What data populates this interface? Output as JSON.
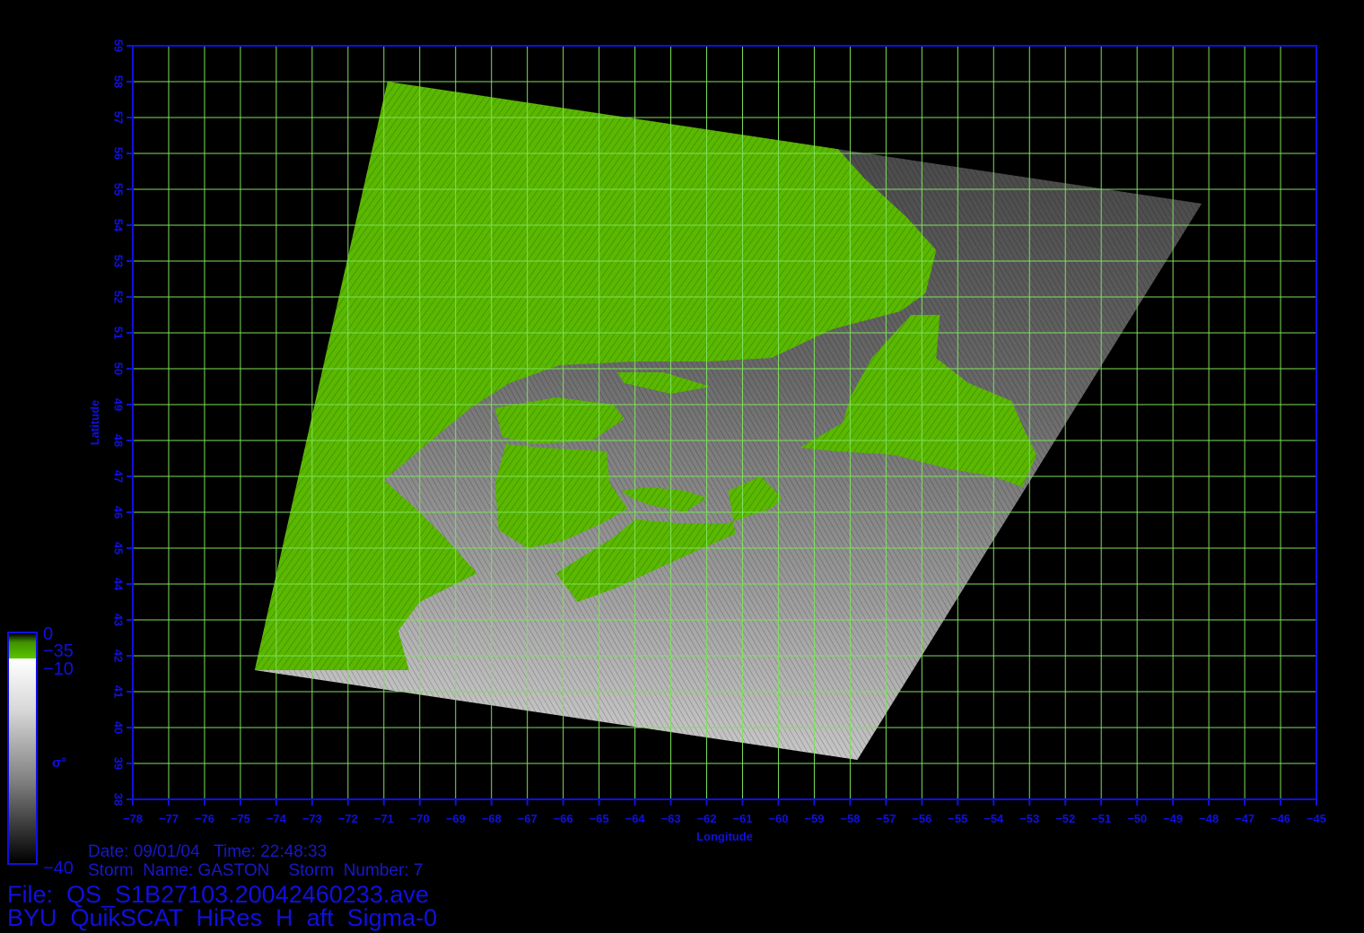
{
  "chart_data": {
    "type": "map",
    "xlabel": "Longitude",
    "ylabel": "Latitude",
    "xlim": [
      -78,
      -45
    ],
    "ylim": [
      38,
      59
    ],
    "x_ticks": [
      -78,
      -77,
      -76,
      -75,
      -74,
      -73,
      -72,
      -71,
      -70,
      -69,
      -68,
      -67,
      -66,
      -65,
      -64,
      -63,
      -62,
      -61,
      -60,
      -59,
      -58,
      -57,
      -56,
      -55,
      -54,
      -53,
      -52,
      -51,
      -50,
      -49,
      -48,
      -47,
      -46,
      -45
    ],
    "y_ticks": [
      38,
      39,
      40,
      41,
      42,
      43,
      44,
      45,
      46,
      47,
      48,
      49,
      50,
      51,
      52,
      53,
      54,
      55,
      56,
      57,
      58,
      59
    ],
    "grid": true,
    "swath_corners_lonlat": [
      [
        -70.9,
        58.0
      ],
      [
        -48.2,
        54.6
      ],
      [
        -57.8,
        39.1
      ],
      [
        -74.6,
        41.6
      ]
    ],
    "colors": {
      "background": "#000000",
      "axis": "#1010e0",
      "grid": "#7ee05a",
      "land": "#5ab800",
      "sea_light": "#ffffff",
      "sea_dark": "#000000"
    }
  },
  "colorbar": {
    "symbol": "σ°",
    "land_max": "0",
    "land_min": "−35",
    "sea_max": "−10",
    "sea_min": "−40"
  },
  "footer": {
    "date_line": "Date: 09/01/04   Time: 22:48:33",
    "storm_line": "Storm  Name: GASTON    Storm  Number: 7",
    "file_line": "File:  QS_S1B27103.20042460233.ave",
    "title_line": "BYU  QuikSCAT  HiRes  H  aft  Sigma-0"
  }
}
